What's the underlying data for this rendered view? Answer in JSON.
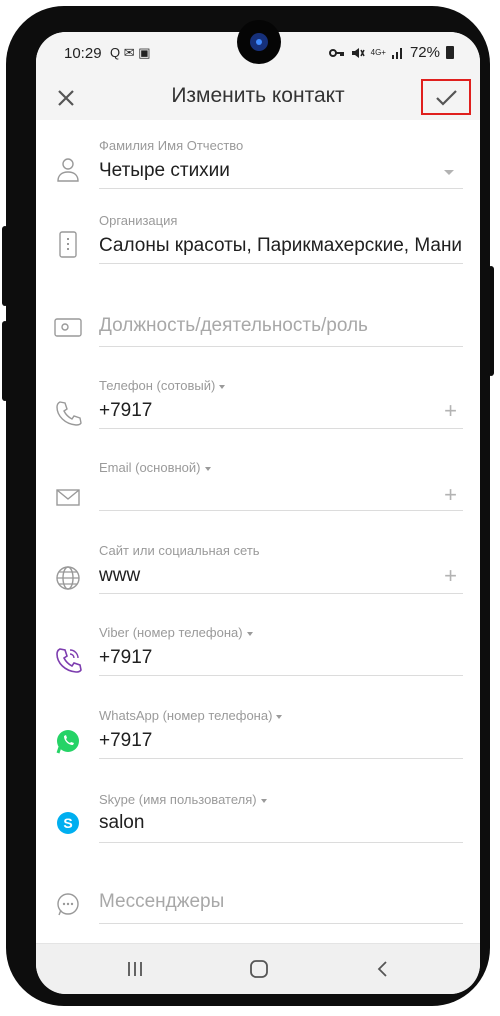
{
  "status_bar": {
    "time": "10:29",
    "left_icons": "Q ✉ ▣",
    "network": "4G+",
    "battery": "72%"
  },
  "app_bar": {
    "title": "Изменить контакт",
    "close_icon": "close-icon",
    "save_icon": "check-icon",
    "highlight_color": "#e0201e"
  },
  "fields": {
    "name": {
      "label": "Фамилия Имя Отчество",
      "value": "Четыре стихии",
      "icon": "person-icon"
    },
    "organization": {
      "label": "Организация",
      "value": "Салоны красоты, Парикмахерские, Маникюр",
      "icon": "building-icon"
    },
    "position": {
      "placeholder": "Должность/деятельность/роль",
      "icon": "id-card-icon"
    },
    "phone": {
      "label": "Телефон (сотовый)",
      "value": "+7917",
      "icon": "phone-icon"
    },
    "email": {
      "label": "Email (основной)",
      "value": "",
      "icon": "mail-icon"
    },
    "website": {
      "label": "Сайт или социальная сеть",
      "value": "www",
      "icon": "globe-icon"
    },
    "viber": {
      "label": "Viber (номер телефона)",
      "value": "+7917",
      "icon": "viber-icon",
      "color": "#7d3daf"
    },
    "whatsapp": {
      "label": "WhatsApp (номер телефона)",
      "value": "+7917",
      "icon": "whatsapp-icon",
      "color": "#25d366"
    },
    "skype": {
      "label": "Skype (имя пользователя)",
      "value": "salon",
      "icon": "skype-icon",
      "color": "#00aff0"
    },
    "messengers": {
      "placeholder": "Мессенджеры",
      "icon": "chat-icon"
    }
  },
  "nav": [
    "recent-apps-icon",
    "home-icon",
    "back-icon"
  ]
}
